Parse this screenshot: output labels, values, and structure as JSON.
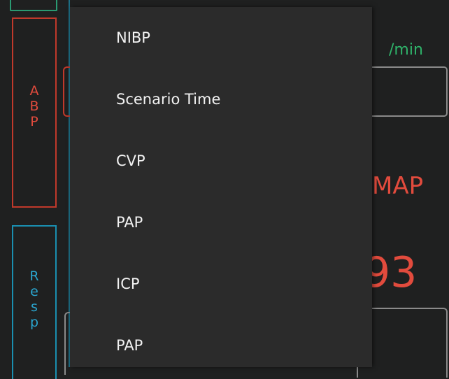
{
  "left_tabs": [
    {
      "label": "ABP",
      "letters": [
        "A",
        "B",
        "P"
      ],
      "color": "#e24b3d"
    },
    {
      "label": "Resp",
      "letters": [
        "R",
        "e",
        "s",
        "p"
      ],
      "color": "#2aa6d0"
    }
  ],
  "right_panel": {
    "rate_unit": "/min",
    "map_label": "MAP",
    "map_value": "93"
  },
  "menu": {
    "items": [
      {
        "label": "NIBP"
      },
      {
        "label": "Scenario Time"
      },
      {
        "label": "CVP"
      },
      {
        "label": "PAP"
      },
      {
        "label": "ICP"
      },
      {
        "label": "PAP"
      }
    ]
  },
  "colors": {
    "background": "#1f2020",
    "menu_background": "#2b2b2b",
    "menu_text": "#f2f2f2",
    "abp_red": "#e24b3d",
    "resp_blue": "#2aa6d0",
    "rate_green": "#2fb36a"
  }
}
